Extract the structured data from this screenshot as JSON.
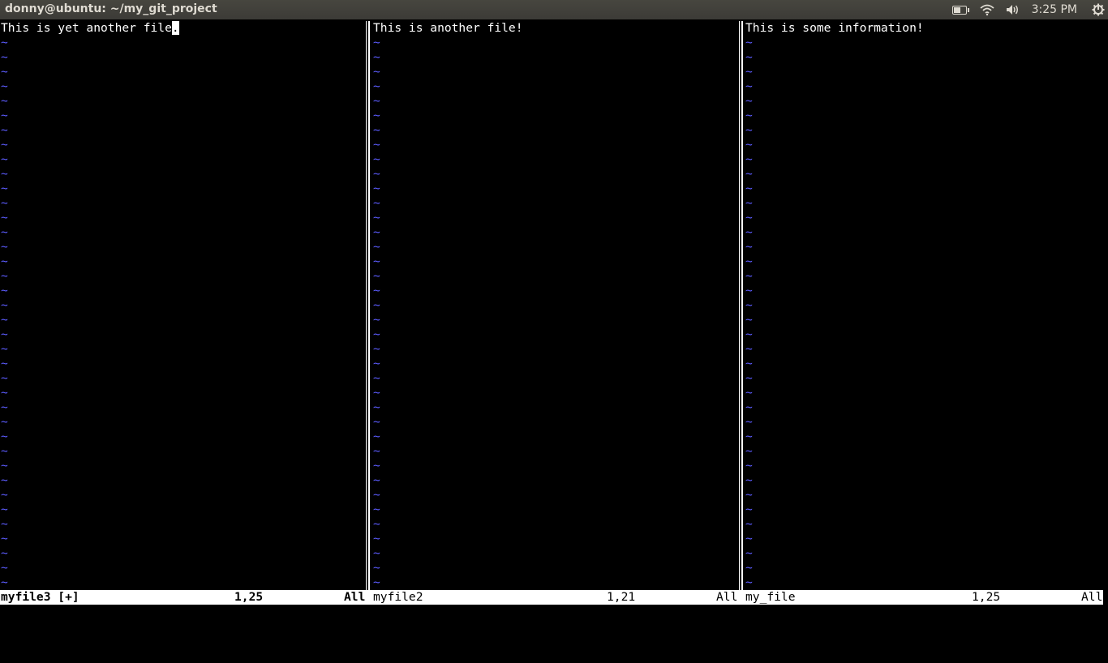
{
  "window": {
    "title": "donny@ubuntu: ~/my_git_project"
  },
  "tray": {
    "battery_level": 0.6,
    "clock": "3:25 PM",
    "icons": [
      "battery-icon",
      "wifi-icon",
      "volume-icon",
      "power-gear-icon"
    ]
  },
  "panes": [
    {
      "content_line": "This is yet another file",
      "cursor_char": ".",
      "status": {
        "filename": "myfile3 [+]",
        "position": "1,25",
        "scroll": "All",
        "active": true
      }
    },
    {
      "content_line": "This is another file!",
      "cursor_char": "",
      "status": {
        "filename": "myfile2",
        "position": "1,21",
        "scroll": "All",
        "active": false
      }
    },
    {
      "content_line": "This is some information!",
      "cursor_char": "",
      "status": {
        "filename": "my_file",
        "position": "1,25",
        "scroll": "All",
        "active": false
      }
    }
  ],
  "empty_line_marker": "~",
  "colors": {
    "tilde": "#5c5cff",
    "background": "#000000",
    "text": "#ffffff",
    "statusline_bg": "#ffffff"
  }
}
